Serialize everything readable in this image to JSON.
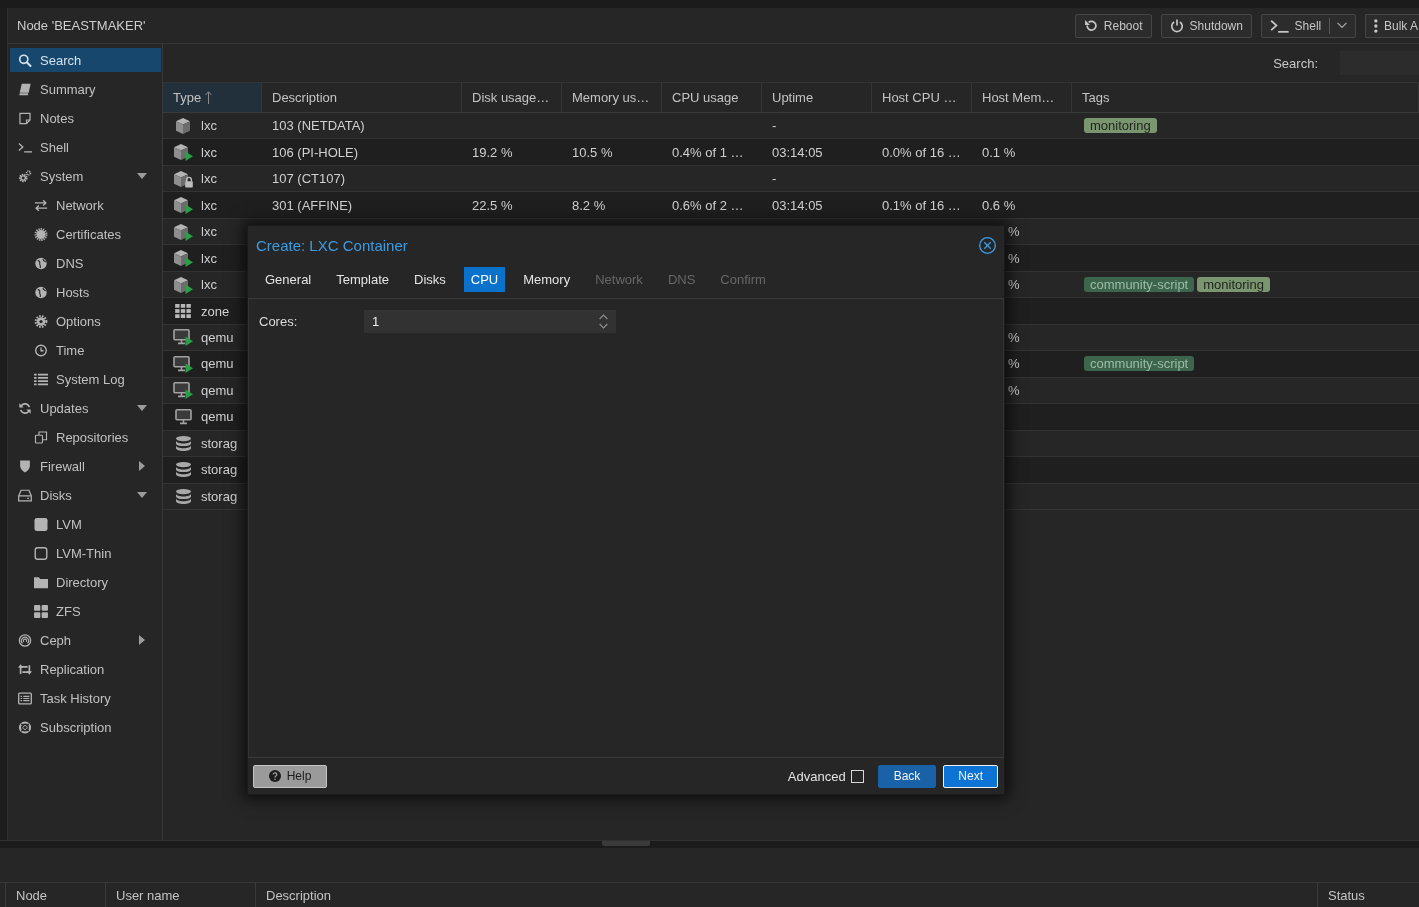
{
  "header": {
    "title": "Node 'BEASTMAKER'",
    "buttons": [
      {
        "label": "Reboot",
        "dropdown": false
      },
      {
        "label": "Shutdown",
        "dropdown": false
      },
      {
        "label": "Shell",
        "dropdown": true
      },
      {
        "label": "Bulk A",
        "dropdown": false
      }
    ]
  },
  "sidebar": {
    "items": [
      {
        "label": "Search",
        "selected": true
      },
      {
        "label": "Summary",
        "selected": false
      },
      {
        "label": "Notes",
        "selected": false
      },
      {
        "label": "Shell",
        "selected": false
      },
      {
        "label": "System",
        "selected": false,
        "expanded": true,
        "children": [
          {
            "label": "Network",
            "selected": false
          },
          {
            "label": "Certificates",
            "selected": false
          },
          {
            "label": "DNS",
            "selected": false
          },
          {
            "label": "Hosts",
            "selected": false
          },
          {
            "label": "Options",
            "selected": false
          },
          {
            "label": "Time",
            "selected": false
          },
          {
            "label": "System Log",
            "selected": false
          }
        ]
      },
      {
        "label": "Updates",
        "selected": false,
        "expanded": true,
        "children": [
          {
            "label": "Repositories",
            "selected": false
          }
        ]
      },
      {
        "label": "Firewall",
        "selected": false,
        "expanded": false
      },
      {
        "label": "Disks",
        "selected": false,
        "expanded": true,
        "children": [
          {
            "label": "LVM",
            "selected": false
          },
          {
            "label": "LVM-Thin",
            "selected": false
          },
          {
            "label": "Directory",
            "selected": false
          },
          {
            "label": "ZFS",
            "selected": false
          }
        ]
      },
      {
        "label": "Ceph",
        "selected": false,
        "expanded": false
      },
      {
        "label": "Replication",
        "selected": false
      },
      {
        "label": "Task History",
        "selected": false
      },
      {
        "label": "Subscription",
        "selected": false
      }
    ]
  },
  "toolbar": {
    "search": {
      "label": "Search:"
    }
  },
  "table": {
    "columns": [
      {
        "label": "Type",
        "sorted": true
      },
      {
        "label": "Description",
        "sorted": false
      },
      {
        "label": "Disk usage…",
        "sorted": false
      },
      {
        "label": "Memory us…",
        "sorted": false
      },
      {
        "label": "CPU usage",
        "sorted": false
      },
      {
        "label": "Uptime",
        "sorted": false
      },
      {
        "label": "Host CPU …",
        "sorted": false
      },
      {
        "label": "Host Mem…",
        "sorted": false
      },
      {
        "label": "Tags",
        "sorted": false
      }
    ],
    "rows": [
      {
        "kind": "lxc",
        "running": false,
        "locked": false,
        "type": "lxc",
        "description": "103 (NETDATA)",
        "uptime": "-",
        "tags": [
          {
            "label": "monitoring",
            "color": "#7b9571"
          }
        ]
      },
      {
        "kind": "lxc",
        "running": true,
        "locked": false,
        "type": "lxc",
        "description": "106 (PI-HOLE)",
        "disk_usage": "19.2 %",
        "memory_usage": "10.5 %",
        "cpu_usage": "0.4% of 1 …",
        "uptime": "03:14:05",
        "host_cpu": "0.0% of 16 …",
        "host_memory": "0.1 %"
      },
      {
        "kind": "lxc",
        "running": false,
        "locked": true,
        "type": "lxc",
        "description": "107 (CT107)",
        "uptime": "-"
      },
      {
        "kind": "lxc",
        "running": true,
        "locked": false,
        "type": "lxc",
        "description": "301 (AFFINE)",
        "disk_usage": "22.5 %",
        "memory_usage": "8.2 %",
        "cpu_usage": "0.6% of 2 …",
        "uptime": "03:14:05",
        "host_cpu": "0.1% of 16 …",
        "host_memory": "0.6 %"
      },
      {
        "kind": "lxc",
        "running": true,
        "locked": false,
        "type": "lxc",
        "host_memory": "%"
      },
      {
        "kind": "lxc",
        "running": true,
        "locked": false,
        "type": "lxc",
        "host_memory": "%"
      },
      {
        "kind": "lxc",
        "running": true,
        "locked": false,
        "type": "lxc",
        "host_memory": "%",
        "tags": [
          {
            "label": "community-script",
            "color": "#3d644c"
          },
          {
            "label": "monitoring",
            "color": "#7b9571"
          }
        ]
      },
      {
        "kind": "zone",
        "type": "zone"
      },
      {
        "kind": "qemu",
        "running": true,
        "locked": false,
        "type": "qemu",
        "host_memory": "%"
      },
      {
        "kind": "qemu",
        "running": true,
        "locked": false,
        "type": "qemu",
        "host_memory": "%",
        "tags": [
          {
            "label": "community-script",
            "color": "#3d644c"
          }
        ]
      },
      {
        "kind": "qemu",
        "running": true,
        "locked": false,
        "type": "qemu",
        "host_memory": "%"
      },
      {
        "kind": "qemu",
        "running": false,
        "locked": false,
        "type": "qemu"
      },
      {
        "kind": "storage",
        "type": "storag"
      },
      {
        "kind": "storage",
        "type": "storag"
      },
      {
        "kind": "storage",
        "type": "storag"
      }
    ]
  },
  "dialog": {
    "title": "Create: LXC Container",
    "tabs": [
      {
        "label": "General",
        "selected": false,
        "disabled": false
      },
      {
        "label": "Template",
        "selected": false,
        "disabled": false
      },
      {
        "label": "Disks",
        "selected": false,
        "disabled": false
      },
      {
        "label": "CPU",
        "selected": true,
        "disabled": false
      },
      {
        "label": "Memory",
        "selected": false,
        "disabled": false
      },
      {
        "label": "Network",
        "selected": false,
        "disabled": true
      },
      {
        "label": "DNS",
        "selected": false,
        "disabled": true
      },
      {
        "label": "Confirm",
        "selected": false,
        "disabled": true
      }
    ],
    "fields": [
      {
        "label": "Cores:",
        "value": "1"
      }
    ],
    "help": "Help",
    "advanced": {
      "label": "Advanced",
      "checked": false
    },
    "buttons": [
      {
        "label": "Back",
        "focused": false
      },
      {
        "label": "Next",
        "focused": true
      }
    ]
  },
  "log_panel": {
    "columns": [
      "Node",
      "User name",
      "Description",
      "Status"
    ]
  }
}
